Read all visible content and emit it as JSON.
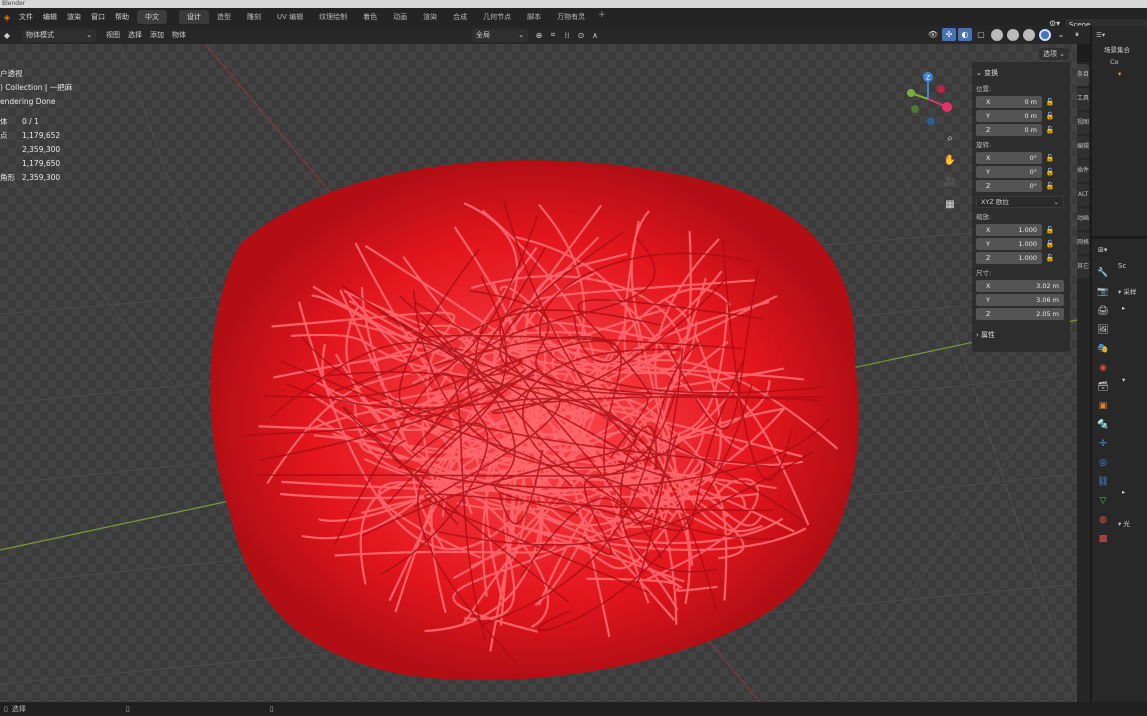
{
  "app": {
    "window_title": "Blender"
  },
  "menu": {
    "items": [
      "文件",
      "编辑",
      "渲染",
      "窗口",
      "帮助"
    ],
    "language": "中文"
  },
  "workspace_tabs": [
    "设计",
    "造型",
    "雕刻",
    "UV 编辑",
    "纹理绘制",
    "着色",
    "动画",
    "渲染",
    "合成",
    "几何节点",
    "脚本",
    "万物有灵"
  ],
  "workspace_add": "+",
  "scene": {
    "name": "Scene"
  },
  "viewport_header": {
    "mode": "物体模式",
    "menus": [
      "视图",
      "选择",
      "添加",
      "物体"
    ],
    "pivot": "全局",
    "options": "选项"
  },
  "viewport": {
    "view_name": "户透视",
    "collection": ") Collection | 一把麻",
    "render_status": "endering Done",
    "stats": [
      {
        "label": "体",
        "value": "0 / 1"
      },
      {
        "label": "点",
        "value": "1,179,652"
      },
      {
        "label": "",
        "value": "2,359,300"
      },
      {
        "label": "",
        "value": "1,179,650"
      },
      {
        "label": "角形",
        "value": "2,359,300"
      }
    ]
  },
  "gizmo": {
    "axes": [
      "Z",
      "Y",
      "X"
    ]
  },
  "npanel": {
    "title": "变换",
    "location": {
      "label": "位置:",
      "x": "0 m",
      "y": "0 m",
      "z": "0 m"
    },
    "rotation": {
      "label": "旋转:",
      "x": "0°",
      "y": "0°",
      "z": "0°"
    },
    "rotation_mode": "XYZ 欧拉",
    "scale": {
      "label": "缩放:",
      "x": "1.000",
      "y": "1.000",
      "z": "1.000"
    },
    "dimensions": {
      "label": "尺寸:",
      "x": "3.02 m",
      "y": "3.06 m",
      "z": "2.05 m"
    },
    "properties_section": "属性",
    "axis_labels": {
      "x": "X",
      "y": "Y",
      "z": "Z"
    }
  },
  "sidebar_tabs": [
    "条目",
    "工具",
    "视图",
    "编辑",
    "插件",
    "ALT",
    "动画",
    "网格",
    "其它"
  ],
  "outliner": {
    "rows": [
      "场景集合",
      "Co",
      "▾"
    ]
  },
  "properties": {
    "header": "Sc",
    "rows": [
      "▾ 采样",
      "▸",
      "▾",
      "▸",
      "▾ 光"
    ]
  },
  "statusbar": {
    "left": "选择"
  },
  "colors": {
    "accent": "#4772b3",
    "yarn": "#e8262c",
    "grid_bg": "#3d3d3d"
  }
}
